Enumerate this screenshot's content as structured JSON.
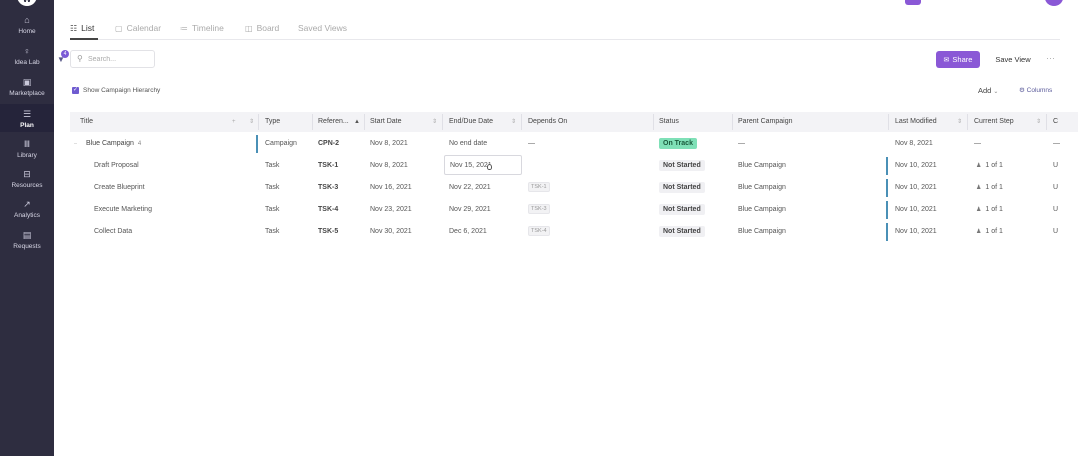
{
  "sidebar": {
    "items": [
      {
        "label": "Home",
        "icon": "⌂"
      },
      {
        "label": "Idea Lab",
        "icon": "♀"
      },
      {
        "label": "Marketplace",
        "icon": "▣"
      },
      {
        "label": "Plan",
        "icon": "☰"
      },
      {
        "label": "Library",
        "icon": "Ⅲ"
      },
      {
        "label": "Resources",
        "icon": "⊟"
      },
      {
        "label": "Analytics",
        "icon": "↗"
      },
      {
        "label": "Requests",
        "icon": "▤"
      }
    ],
    "active": "Plan"
  },
  "tabs": [
    {
      "label": "List",
      "icon": "☷"
    },
    {
      "label": "Calendar",
      "icon": "▢"
    },
    {
      "label": "Timeline",
      "icon": "≔"
    },
    {
      "label": "Board",
      "icon": "◫"
    },
    {
      "label": "Saved Views",
      "icon": ""
    }
  ],
  "filter": {
    "badge": "4"
  },
  "search": {
    "placeholder": "Search..."
  },
  "toolbar": {
    "share_label": "Share",
    "save_view_label": "Save View",
    "more": "···",
    "add_label": "Add",
    "columns_label": "Columns"
  },
  "hierarchy": {
    "label": "Show Campaign Hierarchy",
    "checked": true
  },
  "table": {
    "columns": [
      "Title",
      "Type",
      "Referen...",
      "Start Date",
      "End/Due Date",
      "Depends On",
      "Status",
      "Parent Campaign",
      "Last Modified",
      "Current Step",
      "C"
    ],
    "rows": [
      {
        "title": "Blue Campaign",
        "count": "4",
        "type": "Campaign",
        "ref": "CPN-2",
        "start": "Nov 8, 2021",
        "end": "No end date",
        "depends": "—",
        "status": "On Track",
        "parent": "—",
        "modified": "Nov 8, 2021",
        "step": "—",
        "extra": "—"
      },
      {
        "title": "Draft Proposal",
        "type": "Task",
        "ref": "TSK-1",
        "start": "Nov 8, 2021",
        "end": "Nov 15, 2021",
        "depends": "",
        "status": "Not Started",
        "parent": "Blue Campaign",
        "modified": "Nov 10, 2021",
        "step": "1 of 1",
        "extra": "U"
      },
      {
        "title": "Create Blueprint",
        "type": "Task",
        "ref": "TSK-3",
        "start": "Nov 16, 2021",
        "end": "Nov 22, 2021",
        "depends": "TSK-1",
        "status": "Not Started",
        "parent": "Blue Campaign",
        "modified": "Nov 10, 2021",
        "step": "1 of 1",
        "extra": "U"
      },
      {
        "title": "Execute Marketing",
        "type": "Task",
        "ref": "TSK-4",
        "start": "Nov 23, 2021",
        "end": "Nov 29, 2021",
        "depends": "TSK-3",
        "status": "Not Started",
        "parent": "Blue Campaign",
        "modified": "Nov 10, 2021",
        "step": "1 of 1",
        "extra": "U"
      },
      {
        "title": "Collect Data",
        "type": "Task",
        "ref": "TSK-5",
        "start": "Nov 30, 2021",
        "end": "Dec 6, 2021",
        "depends": "TSK-4",
        "status": "Not Started",
        "parent": "Blue Campaign",
        "modified": "Nov 10, 2021",
        "step": "1 of 1",
        "extra": "U"
      }
    ]
  },
  "colors": {
    "accent": "#8a58d6",
    "sidebar": "#2e2d40",
    "on_track": "#7fe0b7",
    "row_bar": "#4a90b6"
  }
}
